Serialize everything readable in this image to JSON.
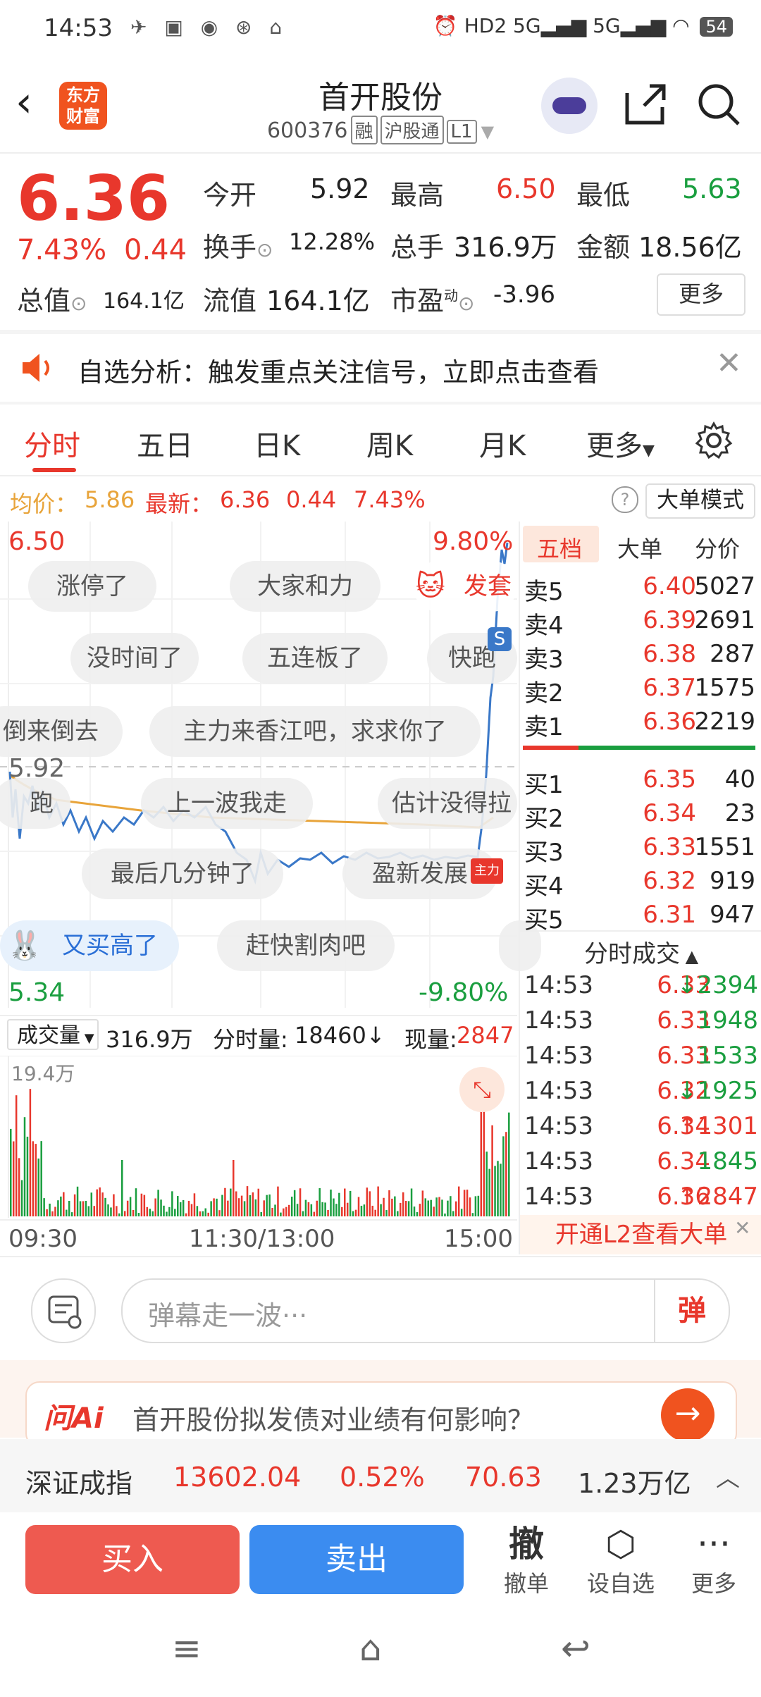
{
  "status": {
    "time": "14:53",
    "hd": "HD2",
    "sig1": "5G",
    "sig2": "5G",
    "battery": "54"
  },
  "header": {
    "logo_line1": "东方",
    "logo_line2": "财富",
    "title": "首开股份",
    "code": "600376",
    "tag1": "融",
    "tag2": "沪股通",
    "tag3": "L1"
  },
  "quote": {
    "price": "6.36",
    "change_pct": "7.43%",
    "change": "0.44",
    "open_label": "今开",
    "open": "5.92",
    "high_label": "最高",
    "high": "6.50",
    "low_label": "最低",
    "low": "5.63",
    "turnover_label": "换手",
    "turnover": "12.28%",
    "volume_label": "总手",
    "volume": "316.9万",
    "amount_label": "金额",
    "amount": "18.56亿",
    "mktcap_label": "总值",
    "mktcap": "164.1亿",
    "float_label": "流值",
    "float": "164.1亿",
    "pe_label": "市盈",
    "pe_sup": "动",
    "pe": "-3.96",
    "more": "更多"
  },
  "banner": {
    "text": "自选分析：触发重点关注信号，立即点击查看"
  },
  "tabs": [
    "分时",
    "五日",
    "日K",
    "周K",
    "月K",
    "更多"
  ],
  "avgline": {
    "avg_label": "均价：",
    "avg": "5.86",
    "latest_label": "最新：",
    "latest": "6.36",
    "change": "0.44",
    "pct": "7.43%",
    "mode": "大单模式",
    "help": "?"
  },
  "chart": {
    "top_price": "6.50",
    "top_pct": "9.80%",
    "bottom_price": "5.34",
    "bottom_pct": "-9.80%",
    "open_ref": "5.92",
    "bubbles": [
      {
        "text": "涨停了"
      },
      {
        "text": "大家和力"
      },
      {
        "text": "发套"
      },
      {
        "text": "没时间了"
      },
      {
        "text": "五连板了"
      },
      {
        "text": "快跑"
      },
      {
        "text": "倒来倒去"
      },
      {
        "text": "主力来香江吧，求求你了"
      },
      {
        "text": "跑"
      },
      {
        "text": "上一波我走"
      },
      {
        "text": "估计没得拉"
      },
      {
        "text": "最后几分钟了"
      },
      {
        "text": "盈新发展"
      },
      {
        "text": "又买高了"
      },
      {
        "text": "赶快割肉吧"
      }
    ],
    "s_marker": "S",
    "line_color": "#3a78c8",
    "avg_color": "#e8a43a"
  },
  "book": {
    "tabs": [
      "五档",
      "大单",
      "分价"
    ],
    "asks": [
      {
        "label": "卖5",
        "price": "6.40",
        "vol": "5027"
      },
      {
        "label": "卖4",
        "price": "6.39",
        "vol": "2691"
      },
      {
        "label": "卖3",
        "price": "6.38",
        "vol": "287"
      },
      {
        "label": "卖2",
        "price": "6.37",
        "vol": "1575"
      },
      {
        "label": "卖1",
        "price": "6.36",
        "vol": "2219"
      }
    ],
    "bids": [
      {
        "label": "买1",
        "price": "6.35",
        "vol": "40"
      },
      {
        "label": "买2",
        "price": "6.34",
        "vol": "23"
      },
      {
        "label": "买3",
        "price": "6.33",
        "vol": "1551"
      },
      {
        "label": "买4",
        "price": "6.32",
        "vol": "919"
      },
      {
        "label": "买5",
        "price": "6.31",
        "vol": "947"
      }
    ],
    "trades_title": "分时成交",
    "trades": [
      {
        "time": "14:53",
        "price": "6.33",
        "vol": "2394",
        "dir": "down"
      },
      {
        "time": "14:53",
        "price": "6.33",
        "vol": "1948",
        "dir": "none"
      },
      {
        "time": "14:53",
        "price": "6.33",
        "vol": "1533",
        "dir": "none"
      },
      {
        "time": "14:53",
        "price": "6.32",
        "vol": "1925",
        "dir": "down"
      },
      {
        "time": "14:53",
        "price": "6.34",
        "vol": "1301",
        "dir": "up"
      },
      {
        "time": "14:53",
        "price": "6.34",
        "vol": "1845",
        "dir": "none"
      },
      {
        "time": "14:53",
        "price": "6.36",
        "vol": "2847",
        "dir": "up"
      }
    ],
    "l2": "开通L2查看大单"
  },
  "volume": {
    "label": "成交量",
    "total": "316.9万",
    "period_label": "分时量:",
    "period": "18460",
    "current_label": "现量:",
    "current": "2847",
    "max": "19.4万"
  },
  "timeaxis": [
    "09:30",
    "11:30/13:00",
    "15:00"
  ],
  "comment": {
    "placeholder": "弹幕走一波···",
    "dm": "弹"
  },
  "ai": {
    "logo": "问Ai",
    "text": "首开股份拟发债对业绩有何影响？"
  },
  "index": {
    "name": "深证成指",
    "value": "13602.04",
    "pct": "0.52%",
    "change": "70.63",
    "amount": "1.23万亿"
  },
  "actions": {
    "buy": "买入",
    "sell": "卖出",
    "cancel_icon": "撤",
    "cancel": "撤单",
    "watch": "设自选",
    "more": "更多"
  }
}
